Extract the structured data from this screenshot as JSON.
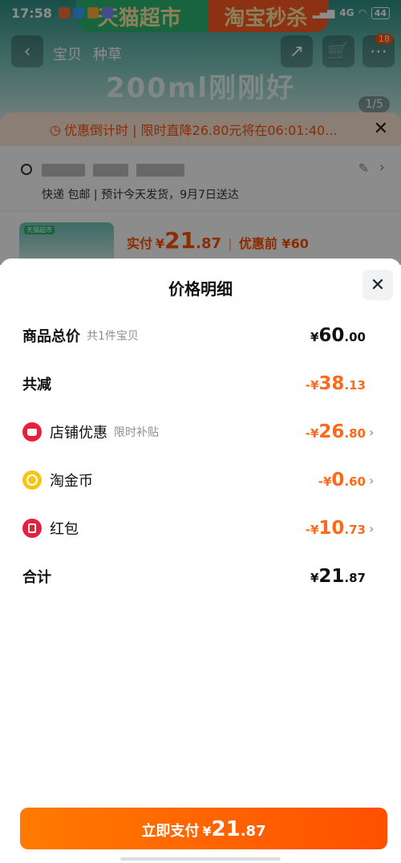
{
  "status_bar": {
    "time": "17:58",
    "network": "4G",
    "battery": "44"
  },
  "background": {
    "banner_left": "天猫超市",
    "banner_right": "淘宝秒杀",
    "slogan": "200ml刚刚好",
    "nav_tabs": [
      "宝贝",
      "种草"
    ],
    "cart_count": "18",
    "page_indicator": "1/5",
    "countdown_text": "优惠倒计时 | 限时直降26.80元将在06:01:40...",
    "delivery_text": "快递 包邮 | 预计今天发货，9月7日送达",
    "product_thumb_tag": "天猫超市",
    "paid_label": "实付",
    "paid_currency": "¥",
    "paid_int": "21",
    "paid_dec": ".87",
    "original_label": "优惠前 ¥60"
  },
  "sheet": {
    "title": "价格明细",
    "rows": [
      {
        "label": "商品总价",
        "hint": "共1件宝贝",
        "amount_prefix": "¥",
        "amount_int": "60",
        "amount_dec": ".00"
      },
      {
        "label": "共减",
        "hint": "",
        "amount_prefix": "-¥",
        "amount_int": "38",
        "amount_dec": ".13"
      },
      {
        "label": "店铺优惠",
        "hint": "限时补贴",
        "amount_prefix": "-¥",
        "amount_int": "26",
        "amount_dec": ".80"
      },
      {
        "label": "淘金币",
        "hint": "",
        "amount_prefix": "-¥",
        "amount_int": "0",
        "amount_dec": ".60"
      },
      {
        "label": "红包",
        "hint": "",
        "amount_prefix": "-¥",
        "amount_int": "10",
        "amount_dec": ".73"
      },
      {
        "label": "合计",
        "hint": "",
        "amount_prefix": "¥",
        "amount_int": "21",
        "amount_dec": ".87"
      }
    ],
    "icons": {
      "store": "store-coupon-icon",
      "coin": "gold-coin-icon",
      "packet": "red-packet-icon"
    },
    "pay_button": {
      "label": "立即支付",
      "currency": "¥",
      "int": "21",
      "dec": ".87"
    }
  },
  "colors": {
    "accent": "#ff5000",
    "discount": "#ff6a1a",
    "store_red": "#e5203c",
    "coin_yellow": "#f5c518"
  }
}
